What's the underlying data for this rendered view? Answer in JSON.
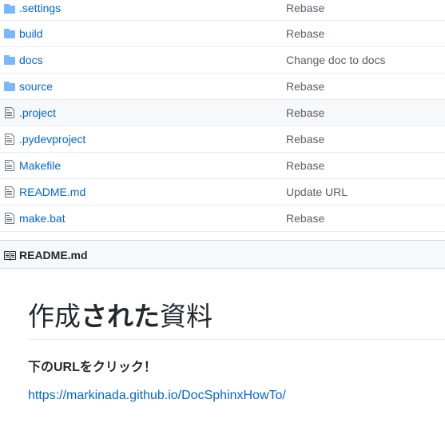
{
  "files": [
    {
      "name": ".settings",
      "type": "folder",
      "message": "Rebase"
    },
    {
      "name": "build",
      "type": "folder",
      "message": "Rebase"
    },
    {
      "name": "docs",
      "type": "folder",
      "message": "Change doc to docs"
    },
    {
      "name": "source",
      "type": "folder",
      "message": "Rebase"
    },
    {
      "name": ".project",
      "type": "file",
      "message": "Rebase"
    },
    {
      "name": ".pydevproject",
      "type": "file",
      "message": "Rebase"
    },
    {
      "name": "Makefile",
      "type": "file",
      "message": "Rebase"
    },
    {
      "name": "README.md",
      "type": "file",
      "message": "Update URL"
    },
    {
      "name": "make.bat",
      "type": "file",
      "message": "Rebase"
    }
  ],
  "readme": {
    "header_title": "README.md",
    "heading_part1": "作成",
    "heading_part2": "された",
    "heading_part3": "資料",
    "subheading": "下のURLをクリック！",
    "link": "https://markinada.github.io/DocSphinxHowTo/"
  },
  "colors": {
    "link": "#0366d6",
    "folder_icon": "#79b8ff",
    "file_icon": "#6a737d"
  }
}
